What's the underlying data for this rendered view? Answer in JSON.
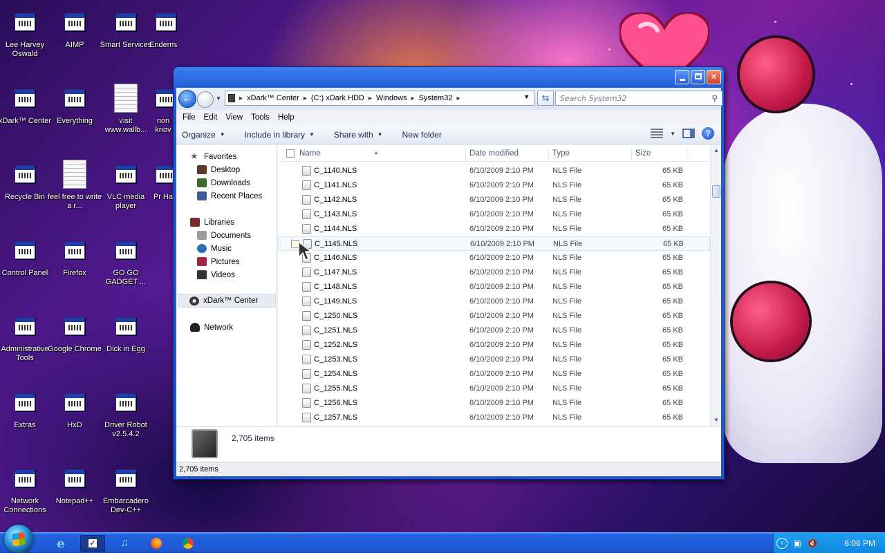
{
  "desktop": {
    "icons": [
      {
        "label": "Lee Harvey Oswald"
      },
      {
        "label": "AIMP"
      },
      {
        "label": "Smart Services"
      },
      {
        "label": "Endermanc..."
      },
      {
        "label": "xDark™ Center"
      },
      {
        "label": "Everything"
      },
      {
        "label": "visit www.wallb..."
      },
      {
        "label": "non knov"
      },
      {
        "label": "Recycle Bin"
      },
      {
        "label": "feel free to write a r..."
      },
      {
        "label": "VLC media player"
      },
      {
        "label": "Pr Ha"
      },
      {
        "label": "Control Panel"
      },
      {
        "label": "Firefox"
      },
      {
        "label": "GO GO GADGET ..."
      },
      {
        "label": "Administrative Tools"
      },
      {
        "label": "Google Chrome"
      },
      {
        "label": "Dick in Egg"
      },
      {
        "label": "Extras"
      },
      {
        "label": "HxD"
      },
      {
        "label": "Driver Robot v2.5.4.2"
      },
      {
        "label": "Network Connections"
      },
      {
        "label": "Notepad++"
      },
      {
        "label": "Embarcadero Dev-C++"
      }
    ]
  },
  "explorer": {
    "address": {
      "crumbs": [
        "xDark™ Center",
        "(C:) xDark HDD",
        "Windows",
        "System32"
      ]
    },
    "search_placeholder": "Search System32",
    "menu": [
      "File",
      "Edit",
      "View",
      "Tools",
      "Help"
    ],
    "toolbar": {
      "organize": "Organize",
      "include": "Include in library",
      "share": "Share with",
      "new_folder": "New folder"
    },
    "nav": {
      "favorites": "Favorites",
      "desktop": "Desktop",
      "downloads": "Downloads",
      "recent": "Recent Places",
      "libraries": "Libraries",
      "documents": "Documents",
      "music": "Music",
      "pictures": "Pictures",
      "videos": "Videos",
      "computer": "xDark™ Center",
      "network": "Network"
    },
    "columns": {
      "name": "Name",
      "date": "Date modified",
      "type": "Type",
      "size": "Size"
    },
    "files": [
      {
        "name": "C_1140.NLS",
        "date": "6/10/2009 2:10 PM",
        "type": "NLS File",
        "size": "65 KB"
      },
      {
        "name": "C_1141.NLS",
        "date": "6/10/2009 2:10 PM",
        "type": "NLS File",
        "size": "65 KB"
      },
      {
        "name": "C_1142.NLS",
        "date": "6/10/2009 2:10 PM",
        "type": "NLS File",
        "size": "65 KB"
      },
      {
        "name": "C_1143.NLS",
        "date": "6/10/2009 2:10 PM",
        "type": "NLS File",
        "size": "65 KB"
      },
      {
        "name": "C_1144.NLS",
        "date": "6/10/2009 2:10 PM",
        "type": "NLS File",
        "size": "65 KB"
      },
      {
        "name": "C_1145.NLS",
        "date": "6/10/2009 2:10 PM",
        "type": "NLS File",
        "size": "65 KB"
      },
      {
        "name": "C_1146.NLS",
        "date": "6/10/2009 2:10 PM",
        "type": "NLS File",
        "size": "65 KB"
      },
      {
        "name": "C_1147.NLS",
        "date": "6/10/2009 2:10 PM",
        "type": "NLS File",
        "size": "65 KB"
      },
      {
        "name": "C_1148.NLS",
        "date": "6/10/2009 2:10 PM",
        "type": "NLS File",
        "size": "65 KB"
      },
      {
        "name": "C_1149.NLS",
        "date": "6/10/2009 2:10 PM",
        "type": "NLS File",
        "size": "65 KB"
      },
      {
        "name": "C_1250.NLS",
        "date": "6/10/2009 2:10 PM",
        "type": "NLS File",
        "size": "65 KB"
      },
      {
        "name": "C_1251.NLS",
        "date": "6/10/2009 2:10 PM",
        "type": "NLS File",
        "size": "65 KB"
      },
      {
        "name": "C_1252.NLS",
        "date": "6/10/2009 2:10 PM",
        "type": "NLS File",
        "size": "65 KB"
      },
      {
        "name": "C_1253.NLS",
        "date": "6/10/2009 2:10 PM",
        "type": "NLS File",
        "size": "65 KB"
      },
      {
        "name": "C_1254.NLS",
        "date": "6/10/2009 2:10 PM",
        "type": "NLS File",
        "size": "65 KB"
      },
      {
        "name": "C_1255.NLS",
        "date": "6/10/2009 2:10 PM",
        "type": "NLS File",
        "size": "65 KB"
      },
      {
        "name": "C_1256.NLS",
        "date": "6/10/2009 2:10 PM",
        "type": "NLS File",
        "size": "65 KB"
      },
      {
        "name": "C_1257.NLS",
        "date": "6/10/2009 2:10 PM",
        "type": "NLS File",
        "size": "65 KB"
      }
    ],
    "details_count": "2,705 items",
    "status": "2,705 items"
  },
  "taskbar": {
    "clock": "6:06 PM"
  },
  "colors": {
    "window_frame": "#1f5ad8",
    "taskbar": "#1e57d2",
    "tray": "#0f86e0"
  }
}
